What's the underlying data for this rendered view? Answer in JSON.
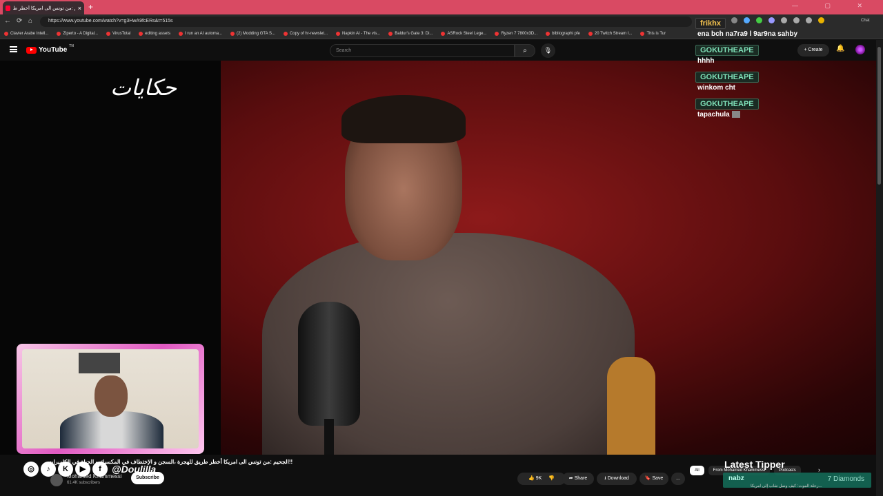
{
  "browser": {
    "tab_title": "الجحيم :من تونس الى امريكا أخطر ط",
    "tab_close": "×",
    "new_tab": "+",
    "url": "https://www.youtube.com/watch?v=g3HwA9fcERs&t=515s",
    "window_controls": "— ▢ ✕",
    "nav_back": "←",
    "nav_forward": "→",
    "nav_reload": "⟳",
    "nav_home": "⌂",
    "chat_ext_label": "Chat",
    "bookmarks": [
      "Clavier Arabe Intell...",
      "Ziperto - A Digital...",
      "VirusTotal",
      "editing assets",
      "I run an AI automa...",
      "(2) Modding GTA S...",
      "Copy of hr-newslet...",
      "Napkin AI - The vis...",
      "Baldur's Gate 3: Di...",
      "ASRock Steel Lege...",
      "Ryzen 7 7800x3D...",
      "bibliographi pfe",
      "20 Twitch Stream I...",
      "This is Tur"
    ],
    "colors": {
      "tabbar": "#d94a63",
      "chrome": "#2b2b2b"
    }
  },
  "youtube": {
    "logo_text": "YouTube",
    "logo_sup": "TN",
    "search_placeholder": "Search",
    "search_icon": "search-icon",
    "mic_icon": "mic-icon",
    "create_label": "Create",
    "bell_icon": "bell-icon",
    "video_overlay_logo": "حكايات",
    "video_title": "الجحيم :من تونس الى امريكا أخطر طريق للهجرة ،السجن و الإختطاف في المكسيك و الحياة في الكاميرات!!",
    "channel_name": "Mohamed Khammessi",
    "subscribers": "61.4K subscribers",
    "subscribe_label": "Subscribe",
    "like_count": "9K",
    "share_label": "Share",
    "download_label": "Download",
    "save_label": "Save",
    "more_label": "...",
    "chips": [
      "All",
      "From Mohamed Khammessi",
      "Podcasts"
    ],
    "chip_next": "›",
    "side_video_title": "رحلة الموت: كيف وصل شاب إلى امريكا..."
  },
  "stream_overlay": {
    "social_handle": "@Doulilla",
    "social_icons": [
      "instagram-icon",
      "tiktok-icon",
      "kick-icon",
      "youtube-icon",
      "facebook-icon"
    ],
    "social_glyphs": [
      "◎",
      "♪",
      "K",
      "▶",
      "f"
    ],
    "chat": [
      {
        "user": "frikhx",
        "message": "ena bch na7ra9 l 9ar9na sahby"
      },
      {
        "user": "GOKUTHEAPE",
        "message": "hhhh"
      },
      {
        "user": "GOKUTHEAPE",
        "message": "winkom cht"
      },
      {
        "user": "GOKUTHEAPE",
        "message": "tapachula"
      }
    ],
    "latest_tipper_title": "Latest Tipper",
    "tipper_name": "nabz",
    "tipper_amount": "7 Diamonds",
    "frame_color": "#e15ac2"
  }
}
